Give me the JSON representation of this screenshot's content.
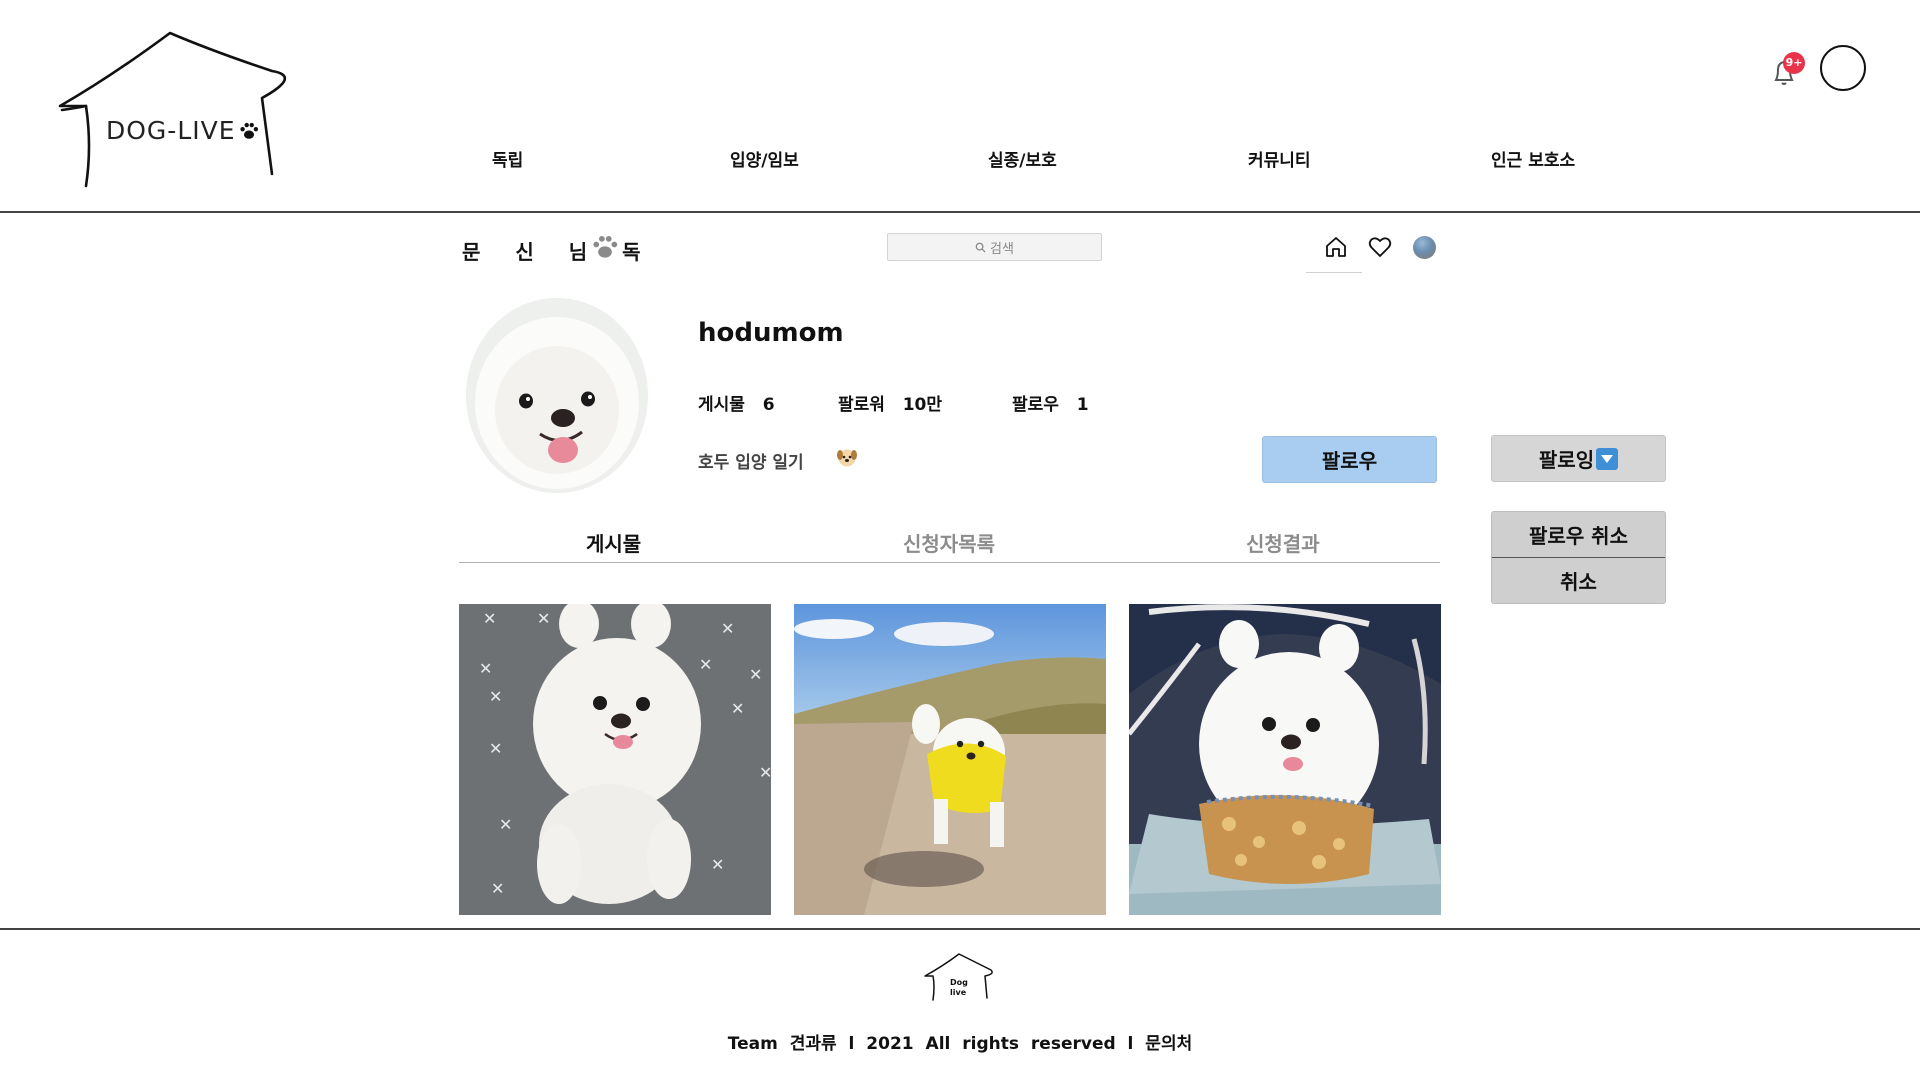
{
  "header": {
    "logo_text": "DOG-LIVE",
    "nav": [
      "독립",
      "입양/임보",
      "실종/보호",
      "커뮤니티",
      "인근  보호소"
    ],
    "notification_badge": "9+"
  },
  "subbar": {
    "brand": "문 신 님 독",
    "search_placeholder": "검색"
  },
  "profile": {
    "username": "hodumom",
    "stats": [
      {
        "label": "게시물",
        "value": "6"
      },
      {
        "label": "팔로워",
        "value": "10만"
      },
      {
        "label": "팔로우",
        "value": "1"
      }
    ],
    "bio": "호두  입양  일기",
    "follow_label": "팔로우",
    "following_label": "팔로잉",
    "menu": {
      "unfollow_label": "팔로우  취소",
      "cancel_label": "취소"
    }
  },
  "tabs": [
    {
      "label": "게시물",
      "active": true
    },
    {
      "label": "신청자목록",
      "active": false
    },
    {
      "label": "신청결과",
      "active": false
    }
  ],
  "posts": [
    {
      "name": "post-dog-on-mat"
    },
    {
      "name": "post-dog-walking"
    },
    {
      "name": "post-dog-in-stroller"
    }
  ],
  "footer": {
    "logo_text_line1": "Dog",
    "logo_text_line2": "live",
    "text": "Team  견과류  l  2021  All  rights  reserved  l  문의처"
  },
  "colors": {
    "follow_button": "#a8cdf0",
    "following_button": "#d6d6d6",
    "badge": "#e8334a"
  }
}
